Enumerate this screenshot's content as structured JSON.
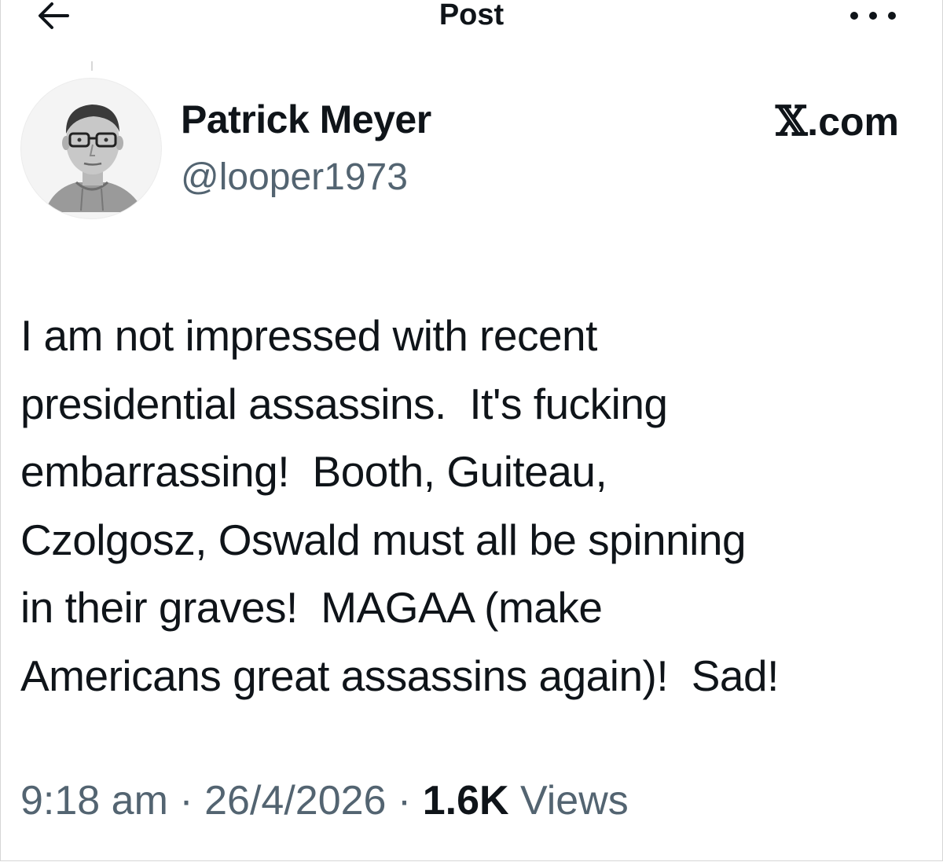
{
  "header": {
    "title": "Post",
    "back_icon": "arrow-left-icon",
    "more_icon": "ellipsis-icon"
  },
  "author": {
    "display_name": "Patrick Meyer",
    "handle": "@looper1973",
    "avatar": "profile-photo-grayscale"
  },
  "brand": {
    "x_letter": "𝕏",
    "suffix": ".com"
  },
  "post": {
    "text": "I am not impressed with recent\npresidential assassins.  It's fucking\nembarrassing!  Booth, Guiteau,\nCzolgosz, Oswald must all be spinning\nin their graves!  MAGAA (make\nAmericans great assassins again)!  Sad!"
  },
  "meta": {
    "time": "9:18 am",
    "separator": "·",
    "date": "26/4/2026",
    "views_count": "1.6K",
    "views_label": "Views"
  },
  "colors": {
    "text_primary": "#0f1419",
    "text_secondary": "#536471",
    "background": "#ffffff"
  }
}
